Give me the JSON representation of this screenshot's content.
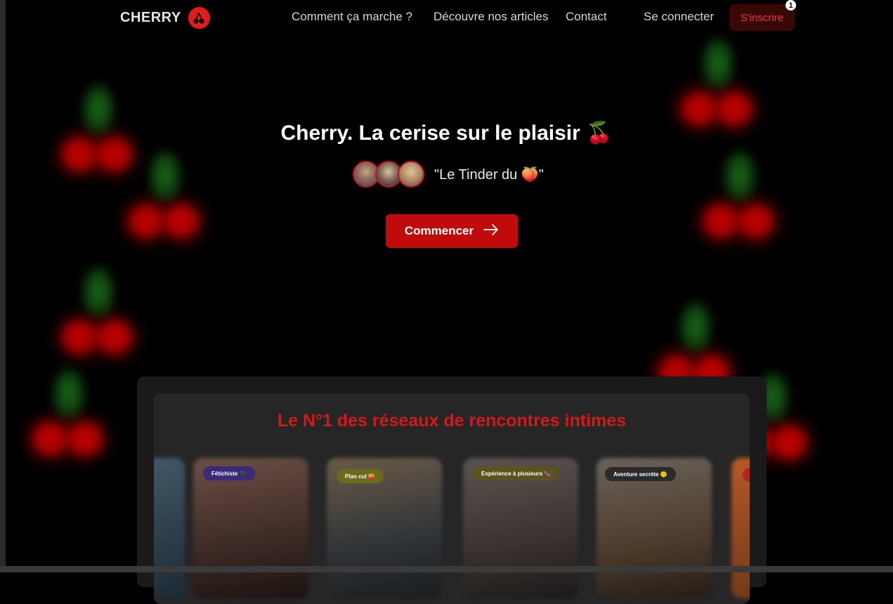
{
  "nav": {
    "logo": "CHERRY",
    "links": [
      "Comment ça marche ?",
      "Découvre nos articles",
      "Contact"
    ],
    "login": "Se connecter",
    "signup": "S'inscrire",
    "badge": "1"
  },
  "hero": {
    "title": "Cherry. La cerise sur le plaisir 🍒",
    "tagline": "\"Le Tinder du 🍑\"",
    "cta": "Commencer"
  },
  "section": {
    "title": "Le N°1 des réseaux de rencontres intimes",
    "cards": [
      {
        "tag": "Fétichiste 🖤",
        "color": "#3a2a7a"
      },
      {
        "tag": "Plan cul 🍑",
        "color": "#6b6a1e"
      },
      {
        "tag": "Expérience à plusieurs 🍆",
        "color": "#5a5220"
      },
      {
        "tag": "Aventure secrète 🤫",
        "color": "#2b2b2b"
      }
    ]
  },
  "colors": {
    "accent": "#c10a0a",
    "background": "#000000"
  }
}
